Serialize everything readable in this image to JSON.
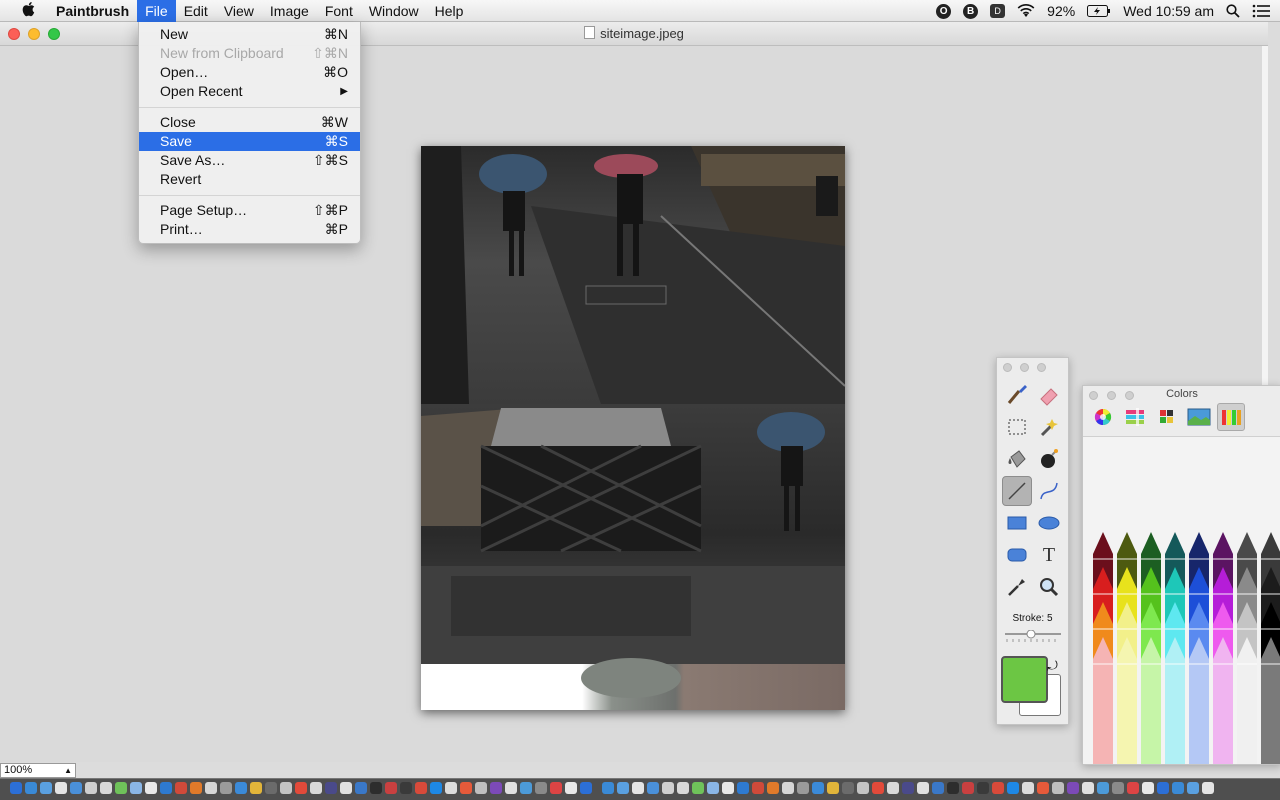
{
  "menubar": {
    "apple_glyph": "",
    "app_name": "Paintbrush",
    "menus": [
      "File",
      "Edit",
      "View",
      "Image",
      "Font",
      "Window",
      "Help"
    ],
    "active_menu": "File",
    "status": {
      "battery": "92%",
      "clock": "Wed 10:59 am"
    }
  },
  "document": {
    "title": "siteimage.jpeg",
    "zoom": "100%"
  },
  "file_menu": {
    "groups": [
      [
        {
          "label": "New",
          "shortcut": "⌘N"
        },
        {
          "label": "New from Clipboard",
          "shortcut": "⇧⌘N",
          "disabled": true
        },
        {
          "label": "Open…",
          "shortcut": "⌘O"
        },
        {
          "label": "Open Recent",
          "shortcut": "▶"
        }
      ],
      [
        {
          "label": "Close",
          "shortcut": "⌘W"
        },
        {
          "label": "Save",
          "shortcut": "⌘S",
          "highlighted": true
        },
        {
          "label": "Save As…",
          "shortcut": "⇧⌘S"
        },
        {
          "label": "Revert",
          "shortcut": ""
        }
      ],
      [
        {
          "label": "Page Setup…",
          "shortcut": "⇧⌘P"
        },
        {
          "label": "Print…",
          "shortcut": "⌘P"
        }
      ]
    ]
  },
  "tools_panel": {
    "tools": [
      "brush-icon",
      "eraser-icon",
      "selection-icon",
      "magic-wand-icon",
      "paint-bucket-icon",
      "bomb-icon",
      "line-icon",
      "curve-icon",
      "rectangle-icon",
      "ellipse-icon",
      "rounded-rect-icon",
      "text-icon",
      "eyedropper-icon",
      "zoom-icon"
    ],
    "selected_tool": "line-icon",
    "stroke_label": "Stroke: 5",
    "stroke_value": 5,
    "foreground_color": "#6cc644",
    "background_color": "#ffffff"
  },
  "colors_panel": {
    "title": "Colors",
    "tabs": [
      "color-wheel-icon",
      "color-sliders-icon",
      "color-palettes-icon",
      "image-palettes-icon",
      "crayons-icon"
    ],
    "selected_tab": "crayons-icon",
    "crayon_rows": [
      [
        "#6b0f1c",
        "#4d5a10",
        "#1c5e22",
        "#14595a",
        "#17266b",
        "#5b1462",
        "#4a4a4a",
        "#3a3a3a"
      ],
      [
        "#d81e1e",
        "#e8e21c",
        "#55c21d",
        "#1ec7b8",
        "#1d4fd8",
        "#b51dd8",
        "#8a8a8a",
        "#1c1c1c"
      ],
      [
        "#f08a1c",
        "#f2f08a",
        "#7ee84e",
        "#5ee8f0",
        "#5a8af0",
        "#ee5aee",
        "#c4c4c4",
        "#000000"
      ],
      [
        "#f5b4b4",
        "#f5f5b0",
        "#c6f5a8",
        "#b0f0f5",
        "#b4c8f5",
        "#f0b4f0",
        "#f0f0f0",
        "#7a7a7a"
      ]
    ]
  },
  "dock": {
    "icon_colors": [
      "#2c6fd6",
      "#3a8ad6",
      "#5aa0e0",
      "#e4e4e4",
      "#4a90d9",
      "#cfcfcf",
      "#d8d8d8",
      "#6fc25a",
      "#8ab6e6",
      "#e8e8e8",
      "#2e7ad0",
      "#d04a3a",
      "#e07a2a",
      "#d6d6d6",
      "#9a9a9a",
      "#3b8ad8",
      "#e2b53a",
      "#6b6b6b",
      "#c4c4c4",
      "#e24a3a",
      "#d9d9d9",
      "#4a4a8a",
      "#e0e0e0",
      "#3a78c8",
      "#2d2d2d",
      "#c94040",
      "#3a3a3a",
      "#d84a3a",
      "#1e88e5",
      "#dcdcdc",
      "#e65a3a",
      "#bfbfbf",
      "#7c4ab8",
      "#e0e0e0",
      "#4c9ad8",
      "#8a8a8a",
      "#d44",
      "#e8e8e8"
    ]
  }
}
